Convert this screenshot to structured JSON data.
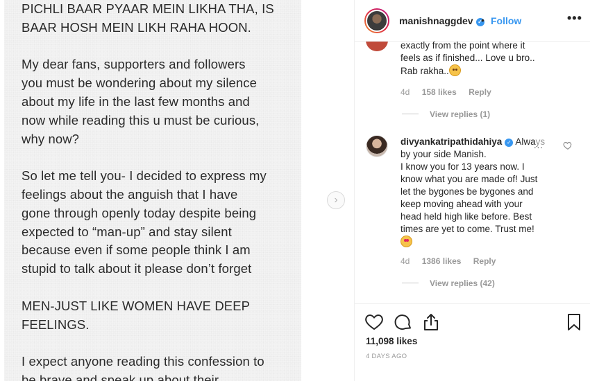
{
  "post_image": {
    "lines": [
      "PICHLI BAAR PYAAR MEIN LIKHA THA, IS",
      "BAAR HOSH MEIN LIKH RAHA HOON.",
      "",
      "My dear fans, supporters and followers",
      "you must be wondering about my silence",
      "about my life in the last few months and",
      "now while reading this u must be curious,",
      "why now?",
      "",
      "So let me tell you- I decided to express my",
      "feelings about the anguish that I have",
      "gone through openly today despite being",
      "expected to “man-up” and stay silent",
      "because even if some people think I am",
      "stupid to talk about it please don’t forget",
      "",
      "MEN-JUST LIKE WOMEN HAVE DEEP",
      "FEELINGS.",
      "",
      "I expect anyone reading this confession to",
      "be brave and speak up about their"
    ],
    "next_icon": "chevron-right-icon"
  },
  "header": {
    "username": "manishnaggdev",
    "verified_icon": "verified-badge-icon",
    "separator": "•",
    "follow_label": "Follow",
    "more_icon": "ellipsis-icon",
    "more_glyph": "•••"
  },
  "comments": [
    {
      "text_lines": [
        "exactly from the point where it",
        "feels as if finished... Love u bro..",
        "Rab rakha.."
      ],
      "emoji_icon": "smiling-face-icon",
      "age": "4d",
      "likes": "158 likes",
      "reply_label": "Reply",
      "view_replies": "View replies (1)"
    },
    {
      "username": "divyankatripathidahiya",
      "verified_icon": "verified-badge-icon",
      "text_first_visible": "Alwa",
      "text_faded": "ys",
      "more_glyph": "...",
      "text_lines": [
        "by your side Manish.",
        "I know you for 13 years now. I",
        "know what you are made of! Just",
        "let the bygones be bygones and",
        "keep moving ahead with your",
        "head held high like before. Best",
        "times are yet to come. Trust me!"
      ],
      "emoji_icon": "star-struck-face-icon",
      "age": "4d",
      "likes": "1386 likes",
      "reply_label": "Reply",
      "view_replies": "View replies (42)"
    }
  ],
  "actions": {
    "like_icon": "heart-icon",
    "comment_icon": "comment-icon",
    "share_icon": "share-icon",
    "save_icon": "bookmark-icon",
    "likes_count": "11,098 likes",
    "date": "4 DAYS AGO"
  },
  "colors": {
    "accent": "#3897f0",
    "muted": "#999999",
    "text": "#262626"
  }
}
